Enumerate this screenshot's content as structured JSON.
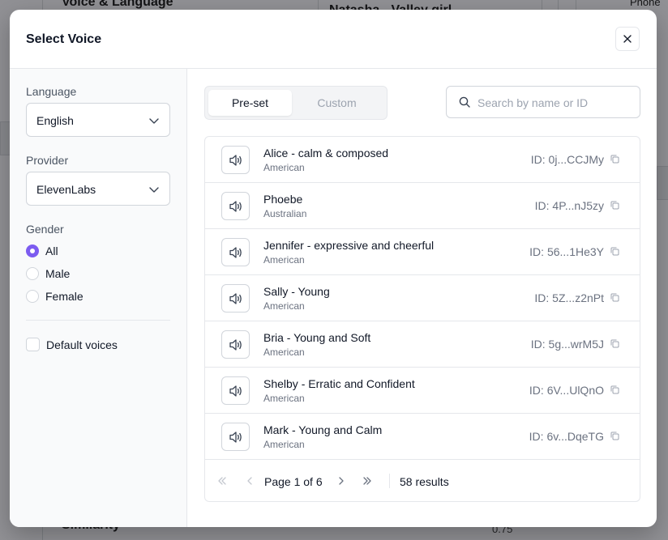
{
  "background": {
    "title": "Voice & Language",
    "voice_name": "Natasha - Valley girl",
    "phone_label": "Phone",
    "similarity_label": "Similarity",
    "similarity_value": "0.75"
  },
  "modal": {
    "title": "Select Voice",
    "close_icon": "close-icon"
  },
  "filters": {
    "language_label": "Language",
    "language_value": "English",
    "provider_label": "Provider",
    "provider_value": "ElevenLabs",
    "gender_label": "Gender",
    "gender_options": [
      {
        "label": "All",
        "checked": true
      },
      {
        "label": "Male",
        "checked": false
      },
      {
        "label": "Female",
        "checked": false
      }
    ],
    "default_voices_label": "Default voices",
    "default_voices_checked": false
  },
  "tabs": [
    {
      "label": "Pre-set",
      "active": true
    },
    {
      "label": "Custom",
      "active": false
    }
  ],
  "search": {
    "placeholder": "Search by name or ID"
  },
  "voices": [
    {
      "name": "Alice - calm & composed",
      "accent": "American",
      "id": "ID: 0j...CCJMy"
    },
    {
      "name": "Phoebe",
      "accent": "Australian",
      "id": "ID: 4P...nJ5zy"
    },
    {
      "name": "Jennifer - expressive and cheerful",
      "accent": "American",
      "id": "ID: 56...1He3Y"
    },
    {
      "name": "Sally - Young",
      "accent": "American",
      "id": "ID: 5Z...z2nPt"
    },
    {
      "name": "Bria - Young and Soft",
      "accent": "American",
      "id": "ID: 5g...wrM5J"
    },
    {
      "name": "Shelby - Erratic and Confident",
      "accent": "American",
      "id": "ID: 6V...UlQnO"
    },
    {
      "name": "Mark - Young and Calm",
      "accent": "American",
      "id": "ID: 6v...DqeTG"
    }
  ],
  "pagination": {
    "page_text": "Page 1 of 6",
    "results_text": "58 results"
  },
  "colors": {
    "accent": "#7c5cf0",
    "border": "#e5e7eb",
    "muted_text": "#6b7280"
  }
}
